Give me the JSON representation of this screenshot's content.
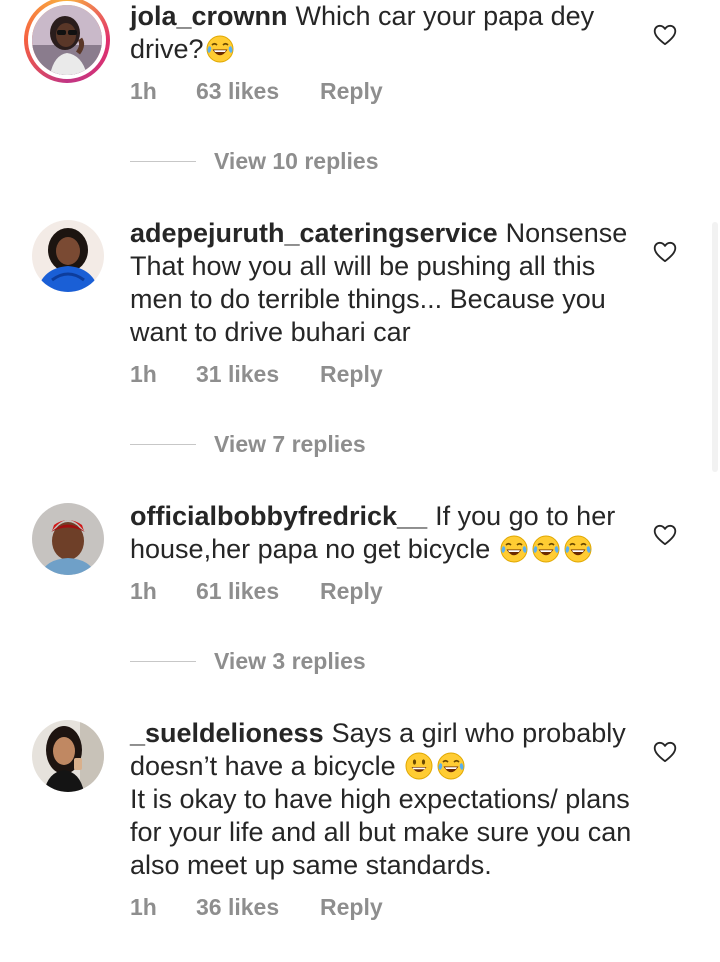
{
  "comments": [
    {
      "username": "jola_crownn",
      "text": "Which car your papa dey drive?",
      "emojis": [
        "tears-of-joy"
      ],
      "time": "1h",
      "likes": "63 likes",
      "reply": "Reply",
      "view_replies": "View 10 replies"
    },
    {
      "username": "adepejuruth_cateringservice",
      "text": "Nonsense That how you all will be pushing all this men to do terrible things... Because you want to drive buhari car",
      "emojis": [],
      "time": "1h",
      "likes": "31 likes",
      "reply": "Reply",
      "view_replies": "View 7 replies"
    },
    {
      "username": "officialbobbyfredrick__",
      "text": "If you go to her house,her papa no get bicycle",
      "emojis": [
        "tears-of-joy",
        "tears-of-joy",
        "tears-of-joy"
      ],
      "time": "1h",
      "likes": "61 likes",
      "reply": "Reply",
      "view_replies": "View 3 replies"
    },
    {
      "username": "_sueldelioness",
      "text_line1": "Says a girl who probably doesn’t have a bicycle",
      "emojis": [
        "grinning",
        "tears-of-joy"
      ],
      "text_line2": "It is okay to have high expectations/ plans for your life and all but make sure you can also meet up same standards.",
      "time": "1h",
      "likes": "36 likes",
      "reply": "Reply"
    }
  ],
  "icons": {
    "like": "heart-outline-icon"
  },
  "colors": {
    "text": "#262626",
    "secondary": "#8e8e8e",
    "divider": "#c7c7c7"
  }
}
